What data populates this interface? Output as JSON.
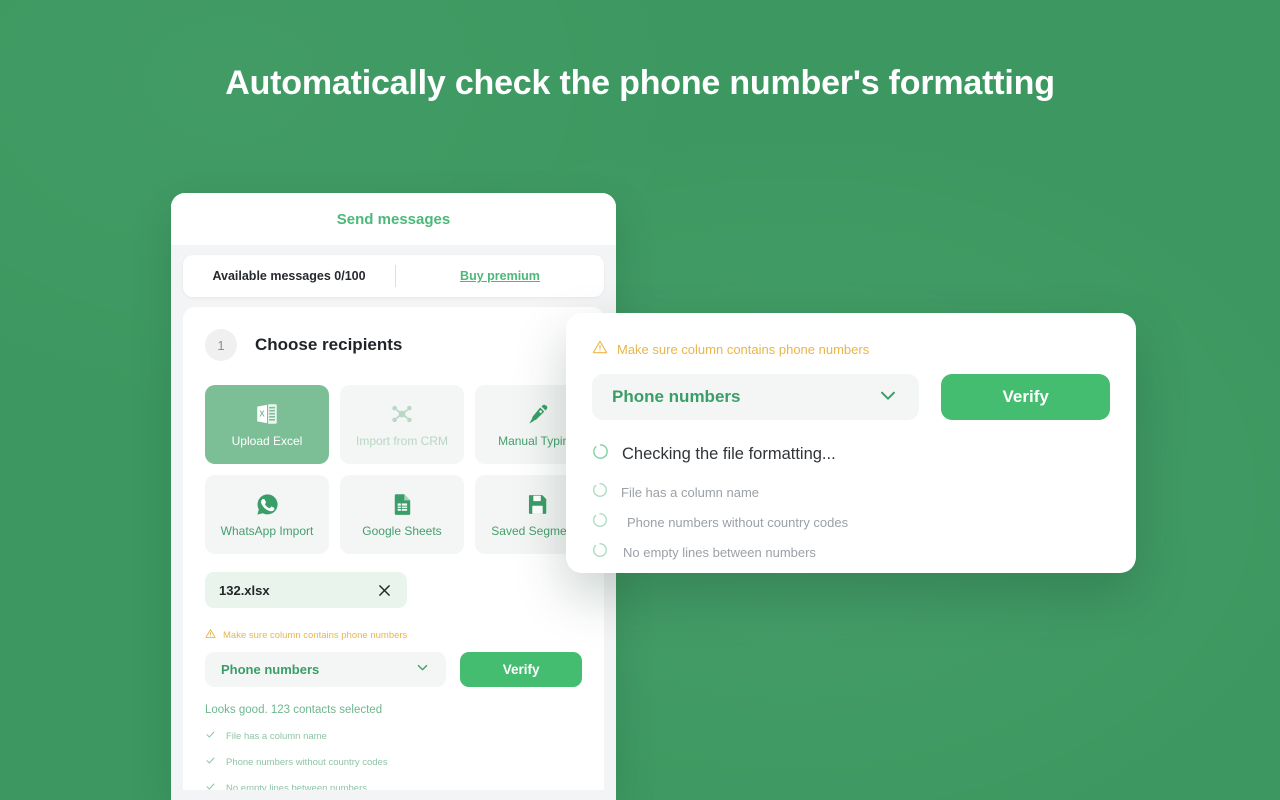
{
  "headline": "Automatically check the phone number's formatting",
  "theme": {
    "background": "#3c9860",
    "accent": "#44bd70",
    "accent_soft": "#7cbf96",
    "warning": "#e8b64a",
    "muted_green": "#8fc4a6"
  },
  "app": {
    "header_title": "Send messages",
    "quota": {
      "label": "Available messages 0/100",
      "buy_link": "Buy premium"
    },
    "step": {
      "number": "1",
      "title": "Choose recipients"
    },
    "sources": [
      {
        "label": "Upload Excel",
        "icon": "excel-file-icon",
        "state": "active"
      },
      {
        "label": "Import from CRM",
        "icon": "crm-network-icon",
        "state": "disabled"
      },
      {
        "label": "Manual Typing",
        "icon": "pen-nib-icon",
        "state": "default"
      },
      {
        "label": "WhatsApp Import",
        "icon": "whatsapp-icon",
        "state": "default"
      },
      {
        "label": "Google Sheets",
        "icon": "google-sheets-icon",
        "state": "default"
      },
      {
        "label": "Saved Segments",
        "icon": "floppy-disk-icon",
        "state": "default"
      }
    ],
    "file": {
      "name": "132.xlsx",
      "remove_icon": "close-icon"
    },
    "warning": "Make sure column contains phone numbers",
    "column_select": {
      "value": "Phone numbers",
      "chevron_icon": "chevron-down-icon"
    },
    "verify_label": "Verify",
    "result": "Looks good. 123 contacts selected",
    "checks": [
      "File has a column name",
      "Phone numbers without country codes",
      "No empty lines between numbers"
    ]
  },
  "popup": {
    "warning": "Make sure column contains phone numbers",
    "column_select": {
      "value": "Phone numbers",
      "chevron_icon": "chevron-down-icon"
    },
    "verify_label": "Verify",
    "status": "Checking the file formatting...",
    "checks": [
      "File has a column name",
      "Phone numbers without country codes",
      "No empty lines between numbers"
    ]
  }
}
